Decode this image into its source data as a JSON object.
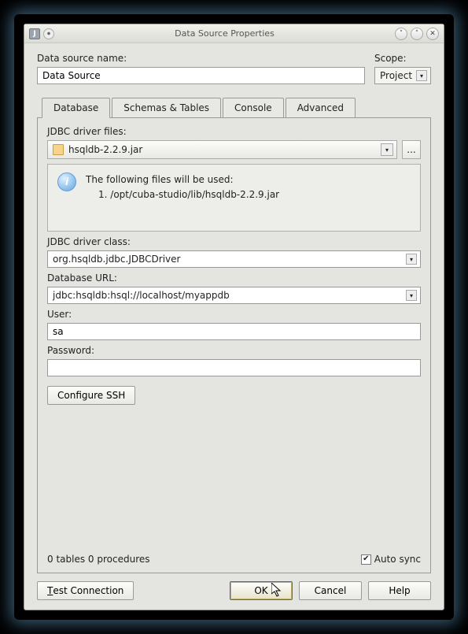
{
  "titlebar": {
    "title": "Data Source Properties"
  },
  "header": {
    "name_label": "Data source name:",
    "name_value": "Data Source",
    "scope_label": "Scope:",
    "scope_value": "Project"
  },
  "tabs": {
    "database": "Database",
    "schemas": "Schemas & Tables",
    "console": "Console",
    "advanced": "Advanced",
    "active": "database"
  },
  "driver": {
    "files_label": "JDBC driver files:",
    "selected": "hsqldb-2.2.9.jar",
    "more_btn": "...",
    "info_line1": "The following files will be used:",
    "info_item_prefix": "1.",
    "info_item_path": "/opt/cuba-studio/lib/hsqldb-2.2.9.jar",
    "class_label": "JDBC driver class:",
    "class_value": "org.hsqldb.jdbc.JDBCDriver"
  },
  "db": {
    "url_label": "Database URL:",
    "url_value": "jdbc:hsqldb:hsql://localhost/myappdb",
    "user_label": "User:",
    "user_value": "sa",
    "password_label": "Password:",
    "password_value": ""
  },
  "configure_ssh": "Configure SSH",
  "status": {
    "text": "0 tables 0 procedures",
    "auto_sync_label": "Auto sync",
    "auto_sync_checked": true
  },
  "footer": {
    "test": "Test Connection",
    "ok": "OK",
    "cancel": "Cancel",
    "help": "Help"
  }
}
